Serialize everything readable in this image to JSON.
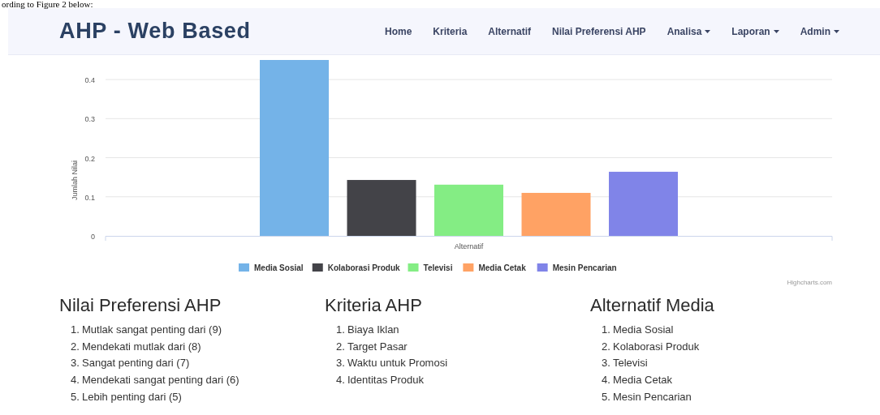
{
  "document_text": "ording to Figure 2 below:",
  "navbar": {
    "brand": "AHP - Web Based",
    "items": [
      {
        "label": "Home",
        "dropdown": false
      },
      {
        "label": "Kriteria",
        "dropdown": false
      },
      {
        "label": "Alternatif",
        "dropdown": false
      },
      {
        "label": "Nilai Preferensi AHP",
        "dropdown": false
      },
      {
        "label": "Analisa",
        "dropdown": true
      },
      {
        "label": "Laporan",
        "dropdown": true
      },
      {
        "label": "Admin",
        "dropdown": true
      }
    ]
  },
  "chart": {
    "chart_data": {
      "type": "bar",
      "grid": true,
      "legend": true,
      "xlabel": "Alternatif",
      "ylabel": "Jumlah Nilai",
      "ylim": [
        0,
        0.45
      ],
      "yticks": [
        0,
        0.1,
        0.2,
        0.3,
        0.4
      ],
      "series": [
        {
          "name": "Media Sosial",
          "color": "#74b3e8",
          "values": [
            0.45
          ]
        },
        {
          "name": "Kolaborasi Produk",
          "color": "#434348",
          "values": [
            0.143
          ]
        },
        {
          "name": "Televisi",
          "color": "#84ed84",
          "values": [
            0.131
          ]
        },
        {
          "name": "Media Cetak",
          "color": "#ffa264",
          "values": [
            0.11
          ]
        },
        {
          "name": "Mesin Pencarian",
          "color": "#8084e8",
          "values": [
            0.164
          ]
        }
      ]
    },
    "credit": "Highcharts.com"
  },
  "sections": [
    {
      "title": "Nilai Preferensi AHP",
      "items": [
        {
          "number": "1.",
          "text": "Mutlak sangat penting dari (9)"
        },
        {
          "number": "2.",
          "text": "Mendekati mutlak dari (8)"
        },
        {
          "number": "3.",
          "text": "Sangat penting dari (7)"
        },
        {
          "number": "4.",
          "text": "Mendekati sangat penting dari (6)"
        },
        {
          "number": "5.",
          "text": "Lebih penting dari (5)"
        }
      ]
    },
    {
      "title": "Kriteria AHP",
      "items": [
        {
          "number": "1.",
          "text": "Biaya Iklan"
        },
        {
          "number": "2.",
          "text": "Target Pasar"
        },
        {
          "number": "3.",
          "text": "Waktu untuk Promosi"
        },
        {
          "number": "4.",
          "text": "Identitas Produk"
        }
      ]
    },
    {
      "title": "Alternatif Media",
      "items": [
        {
          "number": "1.",
          "text": "Media Sosial"
        },
        {
          "number": "2.",
          "text": "Kolaborasi Produk"
        },
        {
          "number": "3.",
          "text": "Televisi"
        },
        {
          "number": "4.",
          "text": "Media Cetak"
        },
        {
          "number": "5.",
          "text": "Mesin Pencarian"
        }
      ]
    }
  ]
}
